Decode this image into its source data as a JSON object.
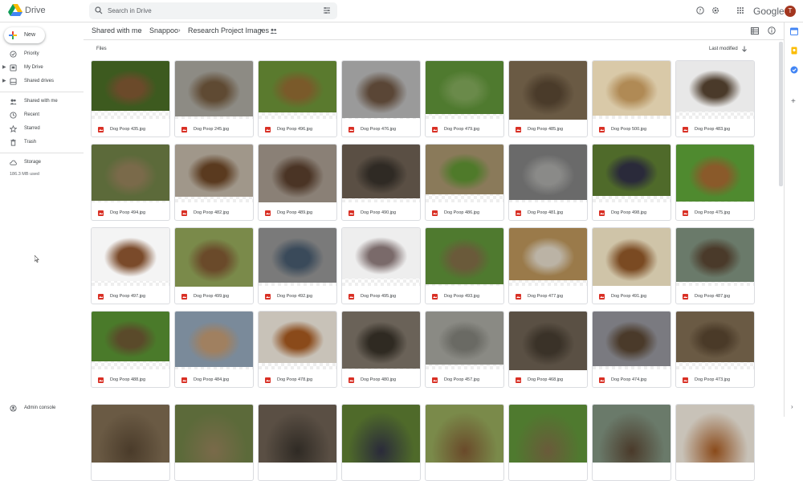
{
  "app": {
    "name": "Drive",
    "google_wordmark": "Google",
    "avatar_letter": "T"
  },
  "search": {
    "placeholder": "Search in Drive"
  },
  "sidebar": {
    "new_label": "New",
    "items": [
      {
        "label": "Priority",
        "icon": "priority-icon"
      },
      {
        "label": "My Drive",
        "icon": "my-drive-icon"
      },
      {
        "label": "Shared drives",
        "icon": "shared-drives-icon"
      },
      {
        "label": "Shared with me",
        "icon": "people-icon"
      },
      {
        "label": "Recent",
        "icon": "clock-icon"
      },
      {
        "label": "Starred",
        "icon": "star-icon"
      },
      {
        "label": "Trash",
        "icon": "trash-icon"
      },
      {
        "label": "Storage",
        "icon": "cloud-icon"
      },
      {
        "label": "Admin console",
        "icon": "admin-icon"
      }
    ],
    "storage_used": "186.3 MB used"
  },
  "breadcrumb": {
    "items": [
      "Shared with me",
      "Snappoo",
      "Research Project Images"
    ]
  },
  "content": {
    "section_label": "Files",
    "sort_label": "Last modified",
    "files": [
      [
        "Dog Poop 435.jpg",
        "Dog Poop 245.jpg",
        "Dog Poop 496.jpg",
        "Dog Poop 476.jpg",
        "Dog Poop 479.jpg",
        "Dog Poop 485.jpg",
        "Dog Poop 500.jpg",
        "Dog Poop 483.jpg"
      ],
      [
        "Dog Poop 494.jpg",
        "Dog Poop 482.jpg",
        "Dog Poop 489.jpg",
        "Dog Poop 490.jpg",
        "Dog Poop 486.jpg",
        "Dog Poop 481.jpg",
        "Dog Poop 498.jpg",
        "Dog Poop 475.jpg"
      ],
      [
        "Dog Poop 497.jpg",
        "Dog Poop 499.jpg",
        "Dog Poop 492.jpg",
        "Dog Poop 495.jpg",
        "Dog Poop 493.jpg",
        "Dog Poop 477.jpg",
        "Dog Poop 491.jpg",
        "Dog Poop 487.jpg"
      ],
      [
        "Dog Poop 488.jpg",
        "Dog Poop 484.jpg",
        "Dog Poop 478.jpg",
        "Dog Poop 480.jpg",
        "Dog Poop 457.jpg",
        "Dog Poop 468.jpg",
        "Dog Poop 474.jpg",
        "Dog Poop 473.jpg"
      ]
    ]
  },
  "colors": {
    "accent": "#1a73e8",
    "file_icon": "#d93025",
    "avatar": "#a3361f"
  }
}
